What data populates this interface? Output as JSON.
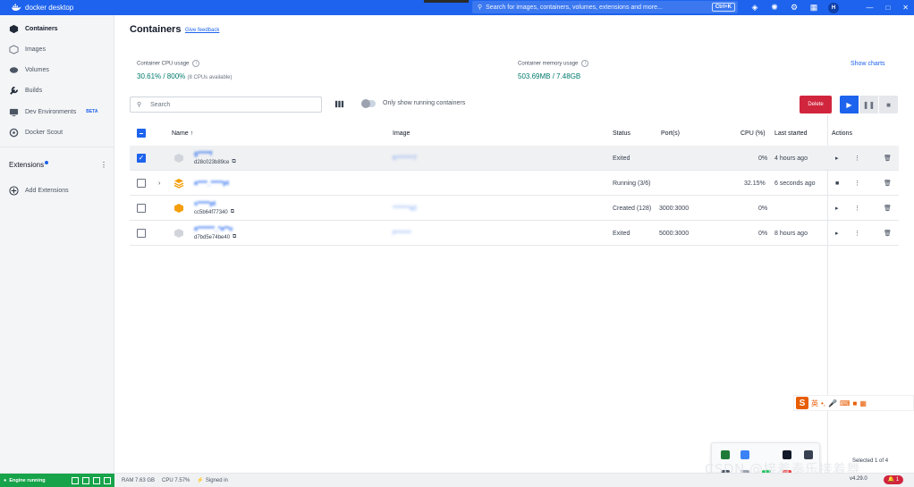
{
  "app": {
    "title": "docker desktop"
  },
  "topbar": {
    "search_placeholder": "Search for images, containers, volumes, extensions and more...",
    "shortcut": "Ctrl+K",
    "avatar_initial": "H",
    "icons": [
      "learning-center-icon",
      "extensions-bug-icon",
      "settings-gear-icon",
      "grid-apps-icon"
    ]
  },
  "sidebar": {
    "items": [
      {
        "label": "Containers",
        "icon": "containers-icon",
        "active": true
      },
      {
        "label": "Images",
        "icon": "images-icon",
        "active": false
      },
      {
        "label": "Volumes",
        "icon": "volumes-icon",
        "active": false
      },
      {
        "label": "Builds",
        "icon": "builds-wrench-icon",
        "active": false
      },
      {
        "label": "Dev Environments",
        "icon": "dev-environments-icon",
        "active": false,
        "badge": "BETA"
      },
      {
        "label": "Docker Scout",
        "icon": "docker-scout-icon",
        "active": false
      }
    ],
    "extensions_label": "Extensions",
    "add_extensions_label": "Add Extensions"
  },
  "main": {
    "title": "Containers",
    "feedback_link": "Give feedback",
    "cpu": {
      "label": "Container CPU usage",
      "value": "30.61% / 800%",
      "sub": "(8 CPUs available)"
    },
    "memory": {
      "label": "Container memory usage",
      "value": "503.69MB / 7.48GB"
    },
    "show_charts": "Show charts",
    "search_placeholder": "Search",
    "only_running_label": "Only show running containers",
    "delete_label": "Delete"
  },
  "table": {
    "columns": [
      "Name",
      "Image",
      "Status",
      "Port(s)",
      "CPU (%)",
      "Last started",
      "Actions"
    ],
    "rows": [
      {
        "name": "g*****f",
        "id": "d28c023b89ce",
        "image": "h*******7",
        "status": "Exited",
        "ports": "",
        "cpu": "0%",
        "last_started": "4 hours ago",
        "checked": true,
        "icon": "container-grey-icon"
      },
      {
        "name": "a****_*****pt",
        "id": "",
        "image": "",
        "status": "Running (3/6)",
        "ports": "",
        "cpu": "32.15%",
        "last_started": "6 seconds ago",
        "checked": false,
        "icon": "compose-stack-icon",
        "expandable": true
      },
      {
        "name": "s*****pt",
        "id": "cc5b64f77340",
        "image": "*******a2",
        "status": "Created (128)",
        "ports": "3000:3000",
        "cpu": "0%",
        "last_started": "",
        "checked": false,
        "icon": "container-orange-icon"
      },
      {
        "name": "a*******_*a**u",
        "id": "d7bd5e74be40",
        "image": "f*******",
        "status": "Exited",
        "ports": "5000:3000",
        "cpu": "0%",
        "last_started": "8 hours ago",
        "checked": false,
        "icon": "container-grey-icon"
      }
    ],
    "selected_count": "Selected 1 of 4"
  },
  "statusbar": {
    "engine": "Engine running",
    "ram": "RAM 7.63 GB",
    "cpu": "CPU 7.57%",
    "signed_in": "Signed in",
    "version": "v4.29.0",
    "notifications": "1"
  },
  "overlay": {
    "ime_label": "英",
    "watermark": "CSDN @接着奏乐接着舞"
  },
  "colors": {
    "brand": "#1d63ed",
    "delete": "#d1253d",
    "engine": "#17a34a",
    "stat": "#00796b"
  }
}
